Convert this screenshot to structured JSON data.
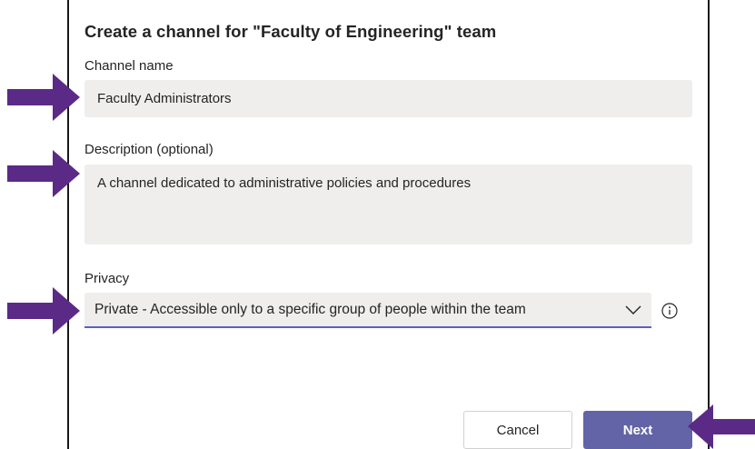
{
  "dialog": {
    "title": "Create a channel for \"Faculty of Engineering\" team",
    "channel_name": {
      "label": "Channel name",
      "value": "Faculty Administrators"
    },
    "description": {
      "label": "Description (optional)",
      "value": "A channel dedicated to administrative policies and procedures"
    },
    "privacy": {
      "label": "Privacy",
      "selected": "Private - Accessible only to a specific group of people within the team"
    },
    "buttons": {
      "cancel": "Cancel",
      "next": "Next"
    }
  },
  "annotations": {
    "arrow_color": "#5b2a86",
    "arrow_targets": [
      "channel-name-input",
      "description-input",
      "privacy-select",
      "next-button"
    ]
  },
  "colors": {
    "accent": "#6264a7",
    "field_bg": "#efeeed",
    "select_underline": "#5b5fc7"
  },
  "icons": [
    "chevron-down-icon",
    "info-icon",
    "arrow-right-icon",
    "arrow-left-icon"
  ]
}
